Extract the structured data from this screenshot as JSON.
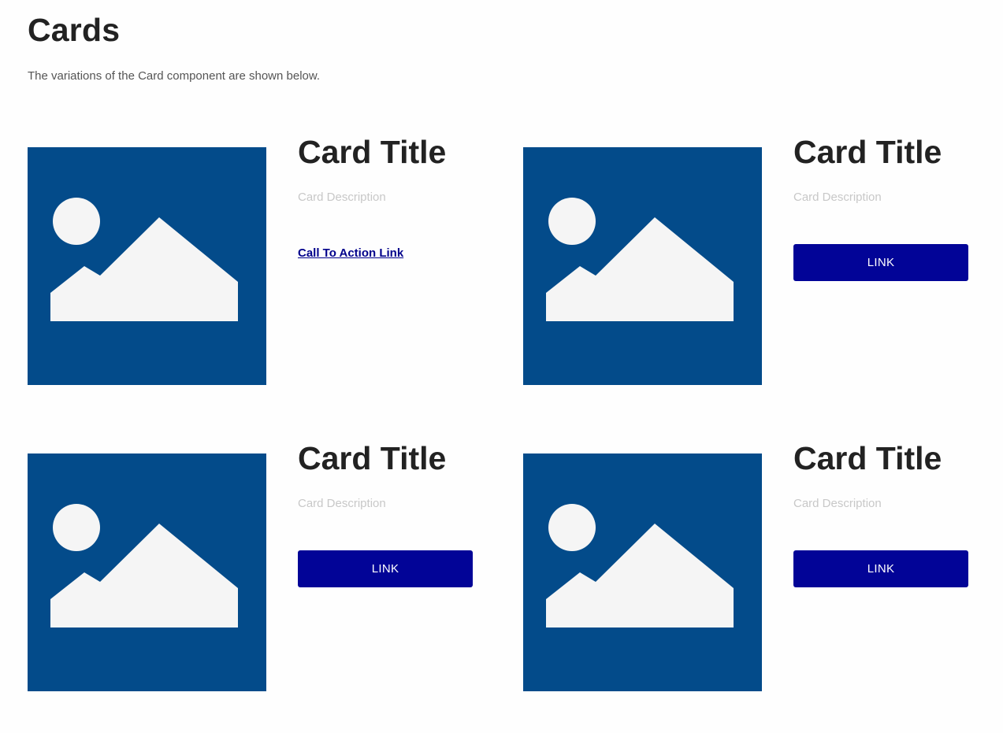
{
  "header": {
    "title": "Cards",
    "subtitle": "The variations of the Card component are shown below."
  },
  "colors": {
    "image_background": "#034b8a",
    "image_foreground": "#f5f5f5",
    "button_background": "#020497",
    "link_color": "#00008b"
  },
  "cards": [
    {
      "title": "Card Title",
      "description": "Card Description",
      "cta_type": "link",
      "cta_label": "Call To Action Link",
      "image_icon": "image-placeholder-icon"
    },
    {
      "title": "Card Title",
      "description": "Card Description",
      "cta_type": "button",
      "cta_label": "LINK",
      "image_icon": "image-placeholder-icon"
    },
    {
      "title": "Card Title",
      "description": "Card Description",
      "cta_type": "button",
      "cta_label": "LINK",
      "image_icon": "image-placeholder-icon"
    },
    {
      "title": "Card Title",
      "description": "Card Description",
      "cta_type": "button",
      "cta_label": "LINK",
      "image_icon": "image-placeholder-icon"
    }
  ]
}
